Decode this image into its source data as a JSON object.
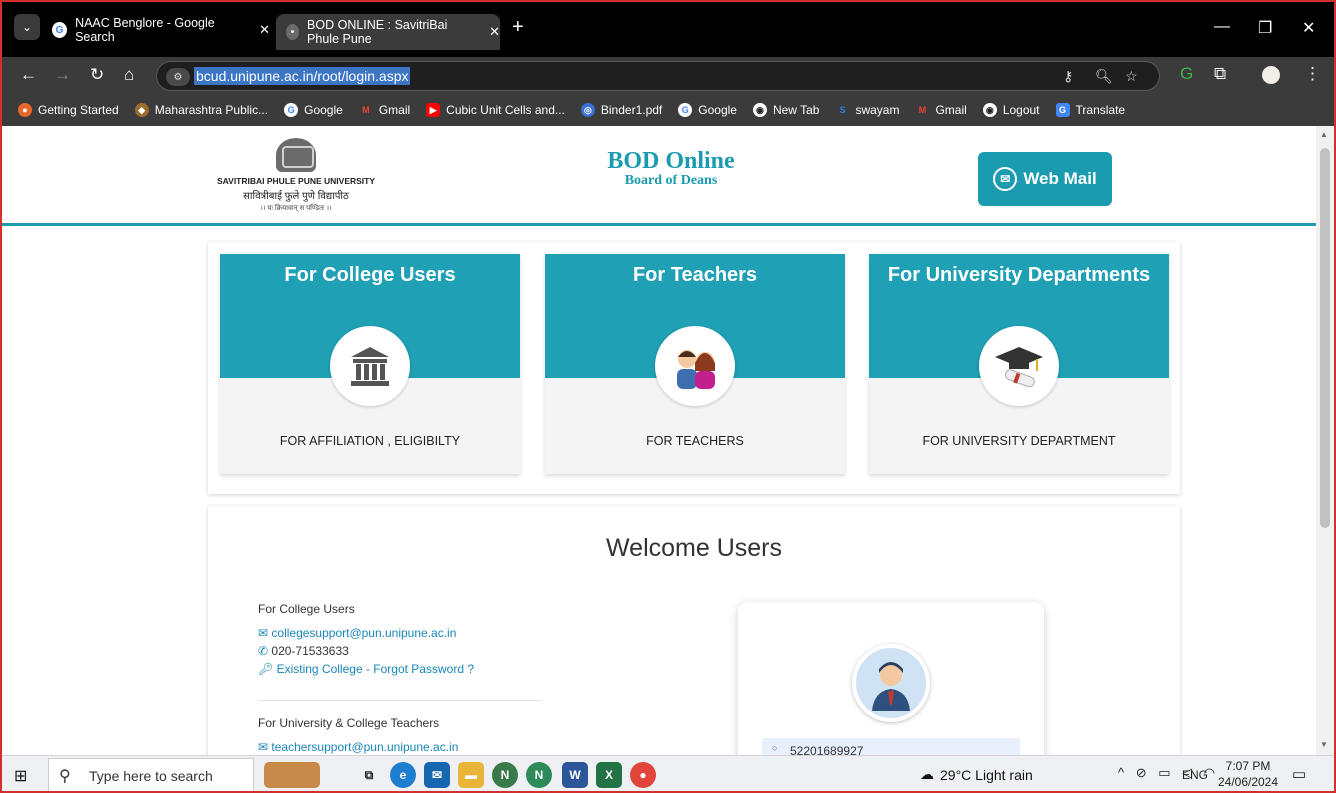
{
  "browser": {
    "tabs": [
      {
        "title": "NAAC Benglore - Google Search",
        "favicon": "google-g"
      },
      {
        "title": "BOD ONLINE : SavitriBai Phule Pune",
        "favicon": "site-emblem"
      }
    ],
    "new_tab": "+",
    "url": "bcud.unipune.ac.in/root/login.aspx",
    "bookmarks": [
      {
        "label": "Getting Started",
        "color": "#e8672a"
      },
      {
        "label": "Maharashtra Public...",
        "color": "#9c6b2e"
      },
      {
        "label": "Google",
        "color": "#4285f4"
      },
      {
        "label": "Gmail",
        "color": "#ea4335"
      },
      {
        "label": "Cubic Unit Cells and...",
        "color": "#ff0000"
      },
      {
        "label": "Binder1.pdf",
        "color": "#3a6fd8"
      },
      {
        "label": "Google",
        "color": "#4285f4"
      },
      {
        "label": "New Tab",
        "color": "#222222"
      },
      {
        "label": "swayam",
        "color": "#2a7de1"
      },
      {
        "label": "Gmail",
        "color": "#ea4335"
      },
      {
        "label": "Logout",
        "color": "#222222"
      },
      {
        "label": "Translate",
        "color": "#4285f4"
      }
    ]
  },
  "header": {
    "university_en": "SAVITRIBAI PHULE PUNE UNIVERSITY",
    "university_mr": "सावित्रीबाई फुले पुणे विद्यापीठ",
    "motto": "।। यः क्रियावान् स पण्डितः ।।",
    "title": "BOD Online",
    "subtitle": "Board of Deans",
    "webmail_label": "Web Mail"
  },
  "cards": [
    {
      "title": "For College Users",
      "caption": "FOR AFFILIATION , ELIGIBILTY",
      "icon": "building-icon"
    },
    {
      "title": "For Teachers",
      "caption": "FOR TEACHERS",
      "icon": "teachers-icon"
    },
    {
      "title": "For University Departments",
      "caption": "FOR UNIVERSITY DEPARTMENT",
      "icon": "graduation-cap-icon"
    }
  ],
  "welcome": {
    "heading": "Welcome Users",
    "college": {
      "label": "For College Users",
      "email": "collegesupport@pun.unipune.ac.in",
      "phone": "020-71533633",
      "forgot": "Existing College - Forgot Password ?"
    },
    "teachers": {
      "label": "For University & College Teachers",
      "email": "teachersupport@pun.unipune.ac.in"
    },
    "login": {
      "user_id": "52201689927"
    }
  },
  "taskbar": {
    "search_placeholder": "Type here to search",
    "weather": "29°C  Light rain",
    "language": "ENG",
    "time": "7:07 PM",
    "date": "24/06/2024"
  },
  "colors": {
    "accent": "#1a9bb0",
    "link": "#1a86b8"
  }
}
